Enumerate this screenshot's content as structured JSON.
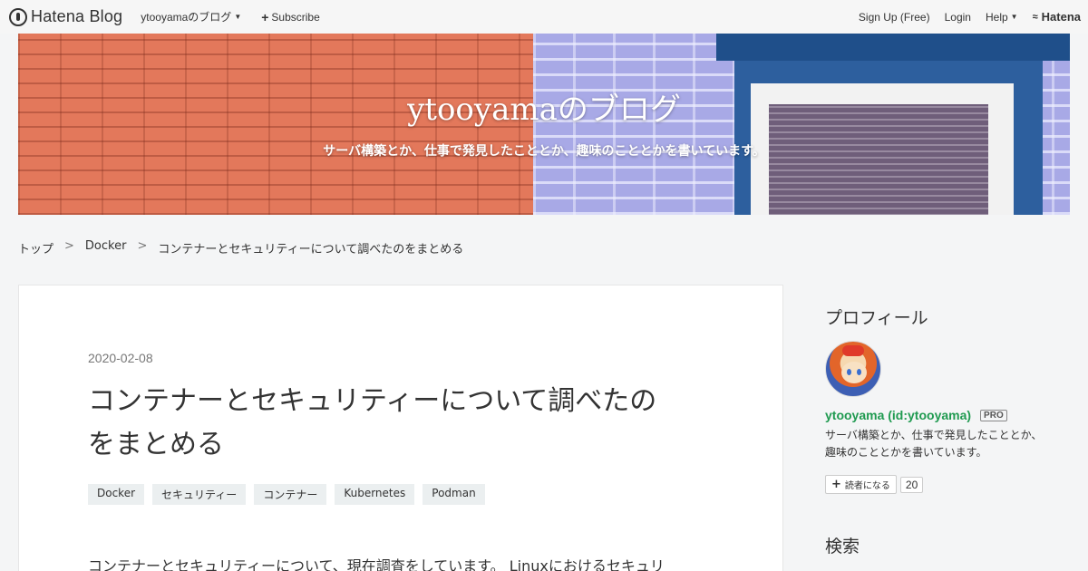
{
  "topbar": {
    "logo_text": "Hatena Blog",
    "blog_menu_label": "ytooyamaのブログ",
    "subscribe_label": "Subscribe",
    "signup_label": "Sign Up (Free)",
    "login_label": "Login",
    "help_label": "Help",
    "hatena_label": "Hatena"
  },
  "header": {
    "title": "ytooyamaのブログ",
    "description": "サーバ構築とか、仕事で発見したこととか、趣味のこととかを書いています。"
  },
  "breadcrumb": {
    "items": [
      "トップ",
      "Docker",
      "コンテナーとセキュリティーについて調べたのをまとめる"
    ],
    "separator": ">"
  },
  "article": {
    "date": "2020-02-08",
    "title_line1": "コンテナーとセキュリティーについて調べたの",
    "title_line2": "をまとめる",
    "tags": [
      "Docker",
      "セキュリティー",
      "コンテナー",
      "Kubernetes",
      "Podman"
    ],
    "body_first_line": "コンテナーとセキュリティーについて、現在調査をしています。 Linuxにおけるセキュリ"
  },
  "sidebar": {
    "profile_heading": "プロフィール",
    "user_name": "ytooyama (id:ytooyama)",
    "pro_badge": "PRO",
    "description_line1": "サーバ構築とか、仕事で発見したこととか、",
    "description_line2": "趣味のこととかを書いています。",
    "reader_button_label": "読者になる",
    "reader_count": "20",
    "search_heading": "検索"
  },
  "colors": {
    "user_name": "#1f9a50",
    "tag_bg": "#ebeff0",
    "page_bg": "#f4f5f6"
  }
}
